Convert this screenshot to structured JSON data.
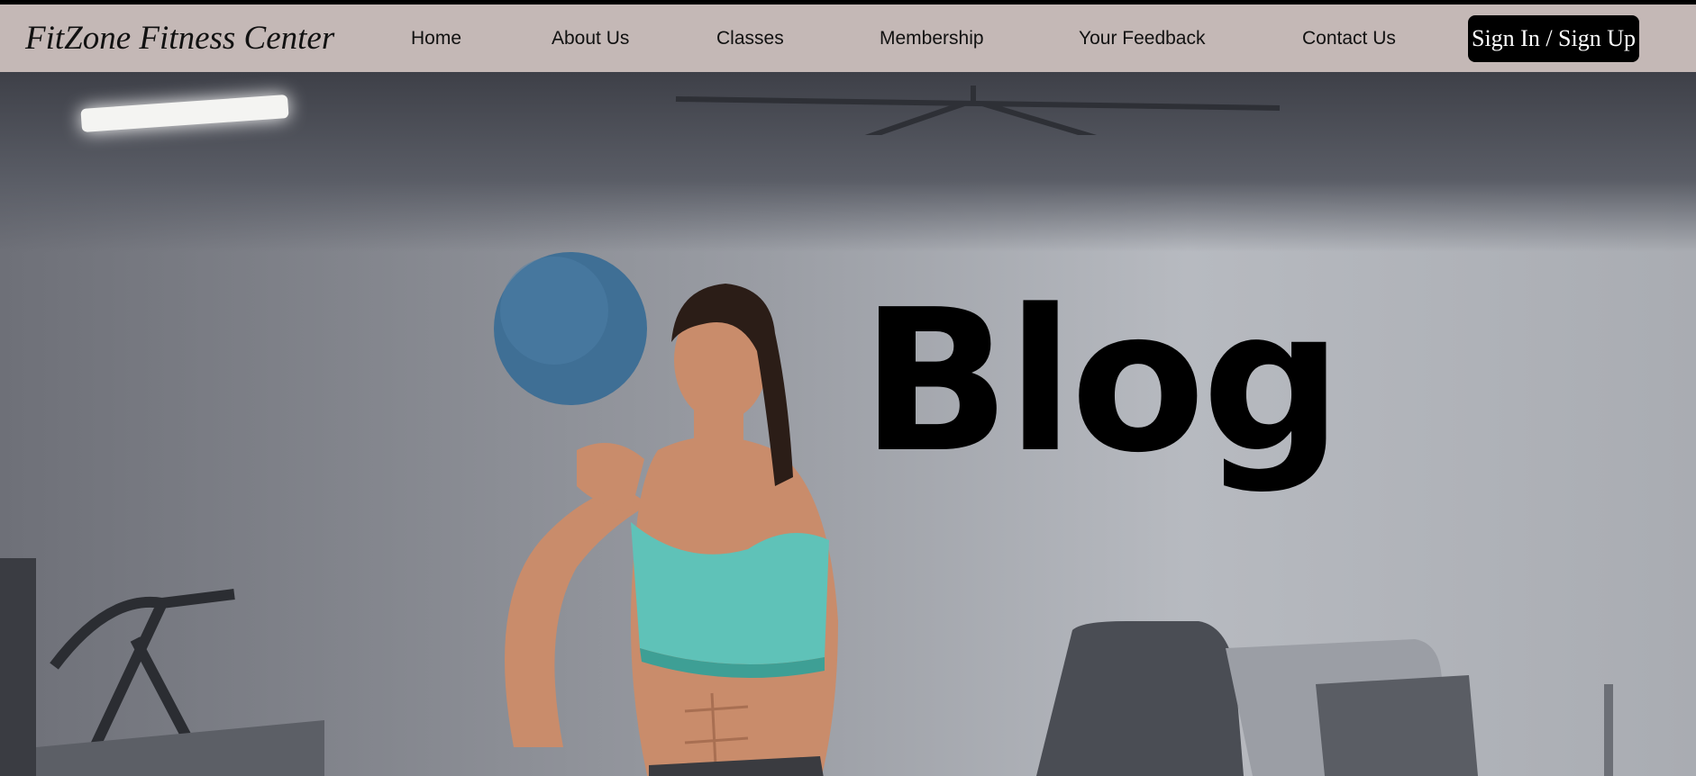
{
  "header": {
    "brand": "FitZone Fitness Center",
    "nav": [
      {
        "label": "Home"
      },
      {
        "label": "About Us"
      },
      {
        "label": "Classes"
      },
      {
        "label": "Membership"
      },
      {
        "label": "Your Feedback"
      },
      {
        "label": "Contact Us"
      }
    ],
    "signin_label": "Sign In / Sign Up"
  },
  "hero": {
    "title": "Blog"
  },
  "colors": {
    "navbar_bg": "#c4b8b6",
    "button_bg": "#000000",
    "sports_bra": "#5fc2b8",
    "medicine_ball": "#3f6f95"
  }
}
